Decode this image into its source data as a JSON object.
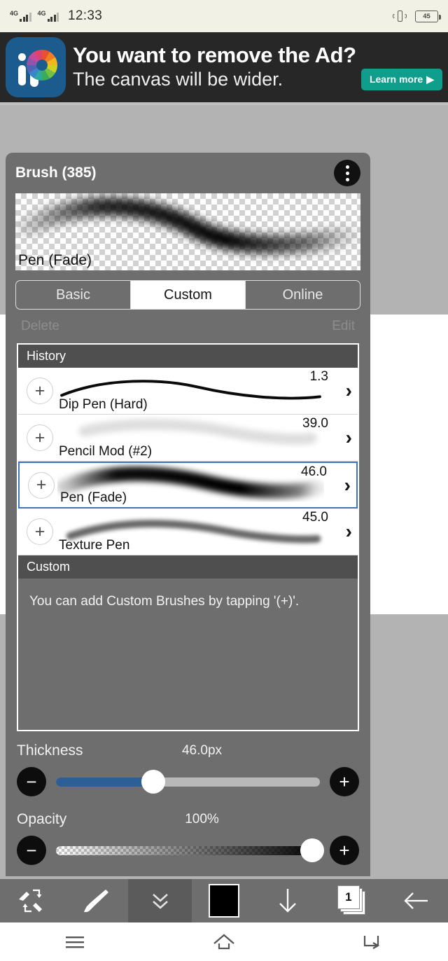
{
  "status_bar": {
    "network_1": "4G",
    "network_2": "4G",
    "time": "12:33",
    "battery_level": "45",
    "vibrate_icon": "vibrate-icon"
  },
  "ad": {
    "logo_alt": "ibispaint-logo",
    "headline": "You want to remove the Ad?",
    "subline": "The canvas will be wider.",
    "cta_label": "Learn more",
    "cta_arrow": "▶",
    "cta_color": "#0f9e8c",
    "background_color": "#272727"
  },
  "panel": {
    "title": "Brush (385)",
    "menu_icon": "three-dot-menu-icon",
    "preview": {
      "label": "Pen (Fade)"
    },
    "tabs": [
      {
        "label": "Basic",
        "active": false
      },
      {
        "label": "Custom",
        "active": true
      },
      {
        "label": "Online",
        "active": false
      }
    ],
    "actions": {
      "delete_label": "Delete",
      "edit_label": "Edit"
    },
    "groups": [
      {
        "header": "History",
        "items": [
          {
            "name": "Dip Pen (Hard)",
            "size": "1.3",
            "selected": false,
            "add_label": "+",
            "chevron": "›"
          },
          {
            "name": "Pencil Mod (#2)",
            "size": "39.0",
            "selected": false,
            "add_label": "+",
            "chevron": "›"
          },
          {
            "name": "Pen (Fade)",
            "size": "46.0",
            "selected": true,
            "add_label": "+",
            "chevron": "›"
          },
          {
            "name": "Texture Pen",
            "size": "45.0",
            "selected": false,
            "add_label": "+",
            "chevron": "›"
          }
        ]
      },
      {
        "header": "Custom",
        "empty_message": "You can add Custom Brushes by tapping '(+)'."
      }
    ],
    "thickness": {
      "label": "Thickness",
      "value_text": "46.0px",
      "percent": 37,
      "minus_label": "−",
      "plus_label": "+",
      "fill_color": "#2c5f96"
    },
    "opacity": {
      "label": "Opacity",
      "value_text": "100%",
      "percent": 97,
      "minus_label": "−",
      "plus_label": "+"
    },
    "selection_color": "#3f74c0"
  },
  "toolbar": {
    "items": [
      {
        "icon": "undo-redo-pen-eraser-icon",
        "active": false
      },
      {
        "icon": "brush-icon",
        "active": false
      },
      {
        "icon": "chevron-double-down-icon",
        "active": true
      },
      {
        "icon": "color-swatch-icon",
        "active": false
      },
      {
        "icon": "arrow-down-icon",
        "active": false
      },
      {
        "icon": "layers-icon",
        "active": false
      },
      {
        "icon": "back-arrow-icon",
        "active": false
      }
    ],
    "layer_count": "1",
    "swatch_color": "#000000"
  },
  "navbar": {
    "items": [
      {
        "icon": "menu-icon"
      },
      {
        "icon": "home-icon"
      },
      {
        "icon": "back-icon"
      }
    ]
  }
}
